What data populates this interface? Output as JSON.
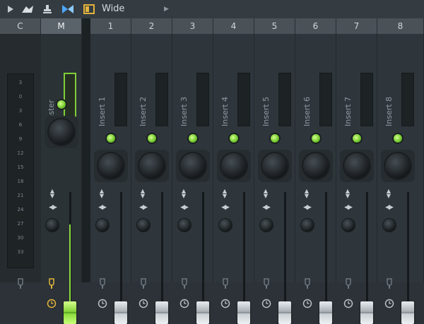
{
  "toolbar": {
    "view_label": "Wide"
  },
  "columns": {
    "current": "C",
    "master": "M"
  },
  "scale_ticks": [
    "3",
    "0",
    "3",
    "6",
    "9",
    "12",
    "15",
    "18",
    "21",
    "24",
    "27",
    "30",
    "33"
  ],
  "master": {
    "name": "Master",
    "fader_level": 0.8,
    "led_on": true
  },
  "inserts": [
    {
      "number": "1",
      "name": "Insert 1",
      "fader_level": 0.8
    },
    {
      "number": "2",
      "name": "Insert 2",
      "fader_level": 0.8
    },
    {
      "number": "3",
      "name": "Insert 3",
      "fader_level": 0.8
    },
    {
      "number": "4",
      "name": "Insert 4",
      "fader_level": 0.8
    },
    {
      "number": "5",
      "name": "Insert 5",
      "fader_level": 0.8
    },
    {
      "number": "6",
      "name": "Insert 6",
      "fader_level": 0.8
    },
    {
      "number": "7",
      "name": "Insert 7",
      "fader_level": 0.8
    },
    {
      "number": "8",
      "name": "Insert 8",
      "fader_level": 0.8
    }
  ],
  "colors": {
    "accent_green": "#8bdc3c",
    "master_border": "#7fce3a",
    "amber": "#e3b43c",
    "bg": "#2c3237"
  },
  "icons": [
    "play-icon",
    "pie-pointer-icon",
    "stamp-icon",
    "butterfly-icon",
    "layout-icon",
    "chevron-right-icon",
    "send-plug-icon",
    "clock-icon"
  ]
}
